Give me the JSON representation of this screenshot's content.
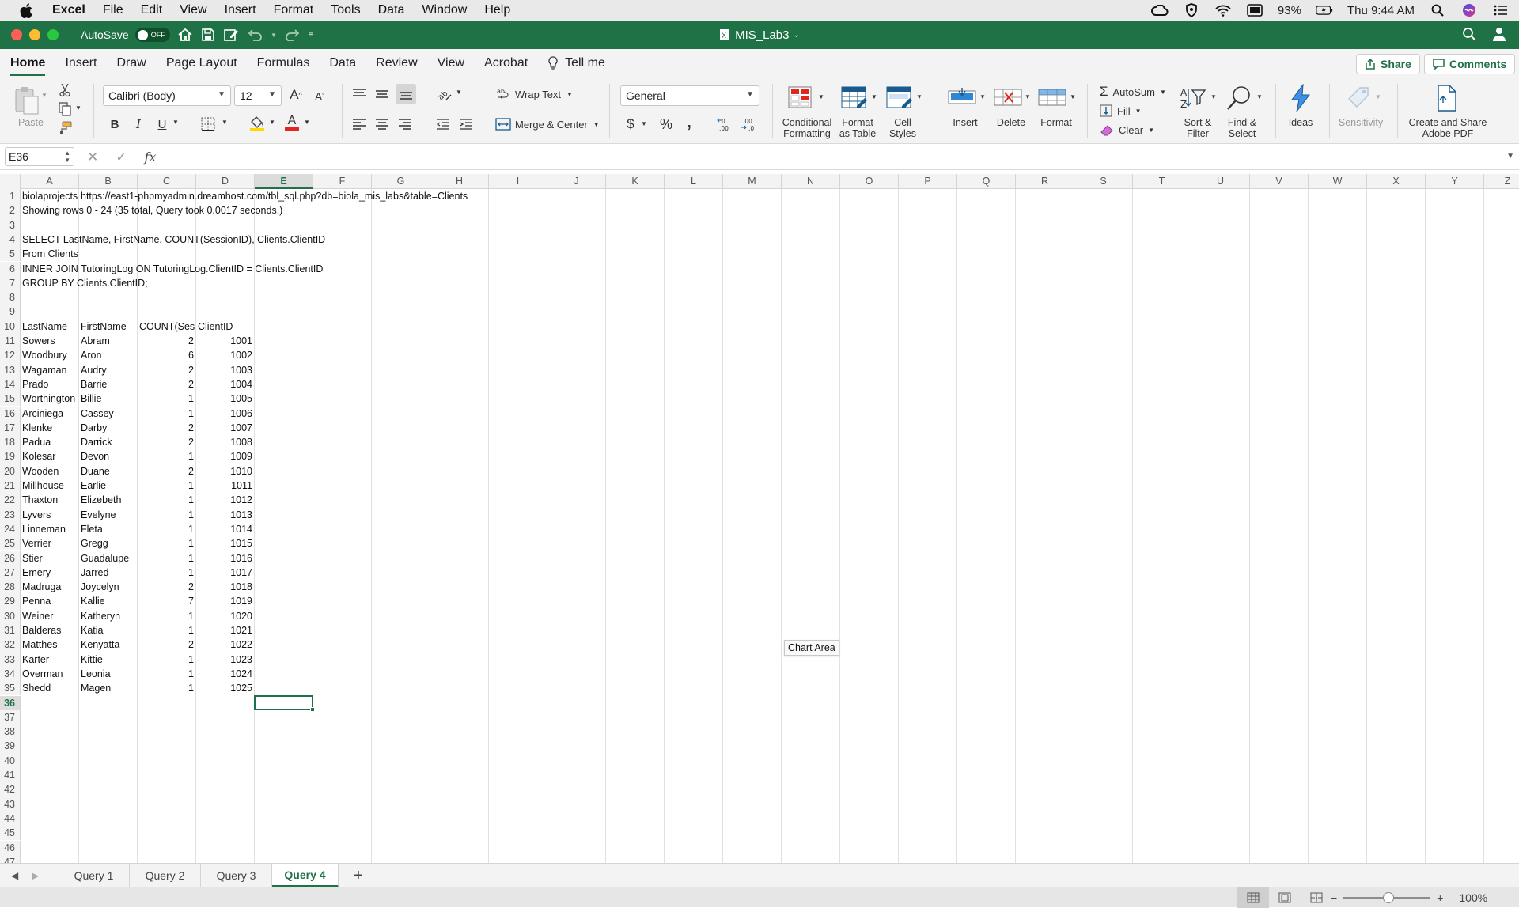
{
  "menubar": {
    "app": "Excel",
    "items": [
      "File",
      "Edit",
      "View",
      "Insert",
      "Format",
      "Tools",
      "Data",
      "Window",
      "Help"
    ],
    "battery": "93%",
    "clock": "Thu 9:44 AM"
  },
  "titlebar": {
    "autosave_label": "AutoSave",
    "autosave_state": "OFF",
    "doc_title": "MIS_Lab3"
  },
  "ribbon_tabs": [
    "Home",
    "Insert",
    "Draw",
    "Page Layout",
    "Formulas",
    "Data",
    "Review",
    "View",
    "Acrobat"
  ],
  "tell_me": "Tell me",
  "share_label": "Share",
  "comments_label": "Comments",
  "ribbon": {
    "paste": "Paste",
    "font_name": "Calibri (Body)",
    "font_size": "12",
    "wrap_text": "Wrap Text",
    "merge_center": "Merge & Center",
    "number_format": "General",
    "conditional_formatting": "Conditional Formatting",
    "conditional_formatting_l1": "Conditional",
    "conditional_formatting_l2": "Formatting",
    "format_table_l1": "Format",
    "format_table_l2": "as Table",
    "cell_styles_l1": "Cell",
    "cell_styles_l2": "Styles",
    "insert": "Insert",
    "delete": "Delete",
    "format": "Format",
    "autosum": "AutoSum",
    "fill": "Fill",
    "clear": "Clear",
    "sort_l1": "Sort &",
    "sort_l2": "Filter",
    "find_l1": "Find &",
    "find_l2": "Select",
    "ideas": "Ideas",
    "sensitivity": "Sensitivity",
    "adobe_l1": "Create and Share",
    "adobe_l2": "Adobe PDF"
  },
  "formula_bar": {
    "name_box": "E36",
    "content": ""
  },
  "columns": [
    "A",
    "B",
    "C",
    "D",
    "E",
    "F",
    "G",
    "H",
    "I",
    "J",
    "K",
    "L",
    "M",
    "N",
    "O",
    "P",
    "Q",
    "R",
    "S",
    "T",
    "U",
    "V",
    "W",
    "X",
    "Y",
    "Z"
  ],
  "selected_cell": "E36",
  "rows_visible": [
    "1",
    "2",
    "3",
    "4",
    "5",
    "6",
    "7",
    "8",
    "9",
    "10",
    "11",
    "12",
    "13",
    "14",
    "15",
    "16",
    "17",
    "18",
    "19",
    "20",
    "21",
    "22",
    "23",
    "24",
    "25",
    "26",
    "27",
    "28",
    "29",
    "30",
    "31",
    "32",
    "33",
    "34",
    "35",
    "36",
    "37",
    "38",
    "39",
    "40",
    "41",
    "42",
    "43",
    "44",
    "45",
    "46",
    "47"
  ],
  "sheet_text": {
    "r1_a": "biolaprojects.imperial.digi",
    "r1_b": "https://east1-phpmyadmin.dreamhost.com/tbl_sql.php?db=biola_mis_labs&table=Clients",
    "r2_a": " Showing rows 0 - 24 (35 total, Query took 0.0017 seconds.)",
    "r4_a": "SELECT LastName, FirstName, COUNT(SessionID), Clients.ClientID",
    "r5_a": "From Clients",
    "r6_a": "INNER JOIN TutoringLog ON TutoringLog.ClientID = Clients.ClientID",
    "r7_a": "GROUP BY Clients.ClientID;"
  },
  "table": {
    "headers": [
      "LastName",
      "FirstName",
      "COUNT(Sess",
      "ClientID"
    ],
    "rows": [
      [
        "Sowers",
        "Abram",
        "2",
        "1001"
      ],
      [
        "Woodbury",
        "Aron",
        "6",
        "1002"
      ],
      [
        "Wagaman",
        "Audry",
        "2",
        "1003"
      ],
      [
        "Prado",
        "Barrie",
        "2",
        "1004"
      ],
      [
        "Worthington",
        "Billie",
        "1",
        "1005"
      ],
      [
        "Arciniega",
        "Cassey",
        "1",
        "1006"
      ],
      [
        "Klenke",
        "Darby",
        "2",
        "1007"
      ],
      [
        "Padua",
        "Darrick",
        "2",
        "1008"
      ],
      [
        "Kolesar",
        "Devon",
        "1",
        "1009"
      ],
      [
        "Wooden",
        "Duane",
        "2",
        "1010"
      ],
      [
        "Millhouse",
        "Earlie",
        "1",
        "1011"
      ],
      [
        "Thaxton",
        "Elizebeth",
        "1",
        "1012"
      ],
      [
        "Lyvers",
        "Evelyne",
        "1",
        "1013"
      ],
      [
        "Linneman",
        "Fleta",
        "1",
        "1014"
      ],
      [
        "Verrier",
        "Gregg",
        "1",
        "1015"
      ],
      [
        "Stier",
        "Guadalupe",
        "1",
        "1016"
      ],
      [
        "Emery",
        "Jarred",
        "1",
        "1017"
      ],
      [
        "Madruga",
        "Joycelyn",
        "2",
        "1018"
      ],
      [
        "Penna",
        "Kallie",
        "7",
        "1019"
      ],
      [
        "Weiner",
        "Katheryn",
        "1",
        "1020"
      ],
      [
        "Balderas",
        "Katia",
        "1",
        "1021"
      ],
      [
        "Matthes",
        "Kenyatta",
        "2",
        "1022"
      ],
      [
        "Karter",
        "Kittie",
        "1",
        "1023"
      ],
      [
        "Overman",
        "Leonia",
        "1",
        "1024"
      ],
      [
        "Shedd",
        "Magen",
        "1",
        "1025"
      ]
    ]
  },
  "chart_tooltip": "Chart Area",
  "sheet_tabs": [
    "Query 1",
    "Query 2",
    "Query 3",
    "Query 4"
  ],
  "active_sheet": "Query 4",
  "zoom": "100%",
  "colors": {
    "excel_green": "#1f7246",
    "ribbon_bg": "#f3f3f3"
  }
}
